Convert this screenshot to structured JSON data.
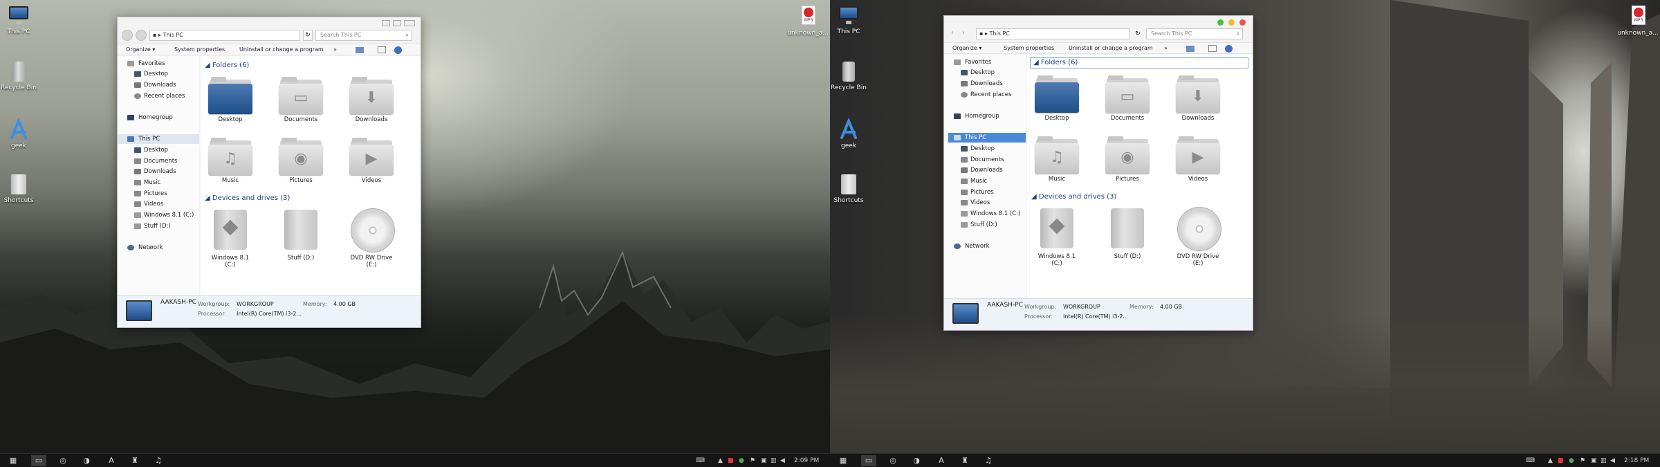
{
  "desktop": {
    "icons_left": [
      {
        "label": "This PC",
        "icon": "monitor-icon"
      },
      {
        "label": "Recycle Bin",
        "icon": "recycle-bin-icon"
      },
      {
        "label": "geek",
        "icon": "app-store-icon"
      },
      {
        "label": "Shortcuts",
        "icon": "folder-icon"
      }
    ],
    "right_icon_left": {
      "label": "unknown_a...",
      "icon": "mp3-file-icon",
      "badge": "MP3"
    },
    "right_icon_right": {
      "label": "unknown_a...",
      "icon": "mp3-file-icon",
      "badge": "MP3"
    }
  },
  "explorer": {
    "location": "This PC",
    "search_placeholder": "Search This PC",
    "toolbar": {
      "organize": "Organize ▾",
      "system_properties": "System properties",
      "uninstall": "Uninstall or change a program",
      "more": "»"
    },
    "nav": {
      "favorites": "Favorites",
      "favorites_items": [
        "Desktop",
        "Downloads",
        "Recent places"
      ],
      "homegroup": "Homegroup",
      "this_pc": "This PC",
      "this_pc_items": [
        "Desktop",
        "Documents",
        "Downloads",
        "Music",
        "Pictures",
        "Videos",
        "Windows 8.1 (C:)",
        "Stuff (D:)"
      ],
      "network": "Network"
    },
    "folders_header": "Folders (6)",
    "folders": [
      {
        "label": "Desktop",
        "icon": "desktop-folder-icon"
      },
      {
        "label": "Documents",
        "icon": "documents-folder-icon"
      },
      {
        "label": "Downloads",
        "icon": "downloads-folder-icon"
      },
      {
        "label": "Music",
        "icon": "music-folder-icon"
      },
      {
        "label": "Pictures",
        "icon": "pictures-folder-icon"
      },
      {
        "label": "Videos",
        "icon": "videos-folder-icon"
      }
    ],
    "devices_header": "Devices and drives (3)",
    "drives": [
      {
        "label": "Windows 8.1 (C:)",
        "icon": "windows-drive-icon"
      },
      {
        "label": "Stuff (D:)",
        "icon": "hard-drive-icon"
      },
      {
        "label": "DVD RW Drive (E:)",
        "icon": "dvd-drive-icon"
      }
    ],
    "details": {
      "pc_name": "AAKASH-PC",
      "workgroup_label": "Workgroup:",
      "workgroup_value": "WORKGROUP",
      "memory_label": "Memory:",
      "memory_value": "4.00 GB",
      "processor_label": "Processor:",
      "processor_value": "Intel(R) Core(TM) i3-2..."
    }
  },
  "taskbar_left": {
    "time": "2:09 PM"
  },
  "taskbar_right": {
    "time": "2:18 PM"
  },
  "colors": {
    "selection": "#4a89d8",
    "group_header": "#1e3f8a",
    "mac_close": "#f0524f",
    "mac_min": "#f5b82e",
    "mac_max": "#45c23f",
    "taskbar": "#151515"
  }
}
